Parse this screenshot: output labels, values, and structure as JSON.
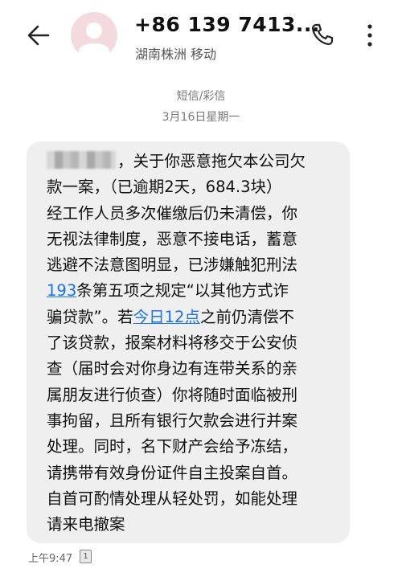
{
  "header": {
    "phone_number": "+86 139 7413...",
    "location": "湖南株洲 移动",
    "back_icon": "back-arrow-icon",
    "call_icon": "phone-icon",
    "more_icon": "more-vertical-icon",
    "avatar_color": "#f3dbdd"
  },
  "conversation": {
    "message_type": "短信/彩信",
    "date": "3月16日星期一"
  },
  "message": {
    "lines": [
      {
        "parts": [
          {
            "text": "",
            "type": "redacted"
          },
          {
            "text": "，关于你恶意拖欠本公司欠",
            "type": "text"
          }
        ]
      },
      {
        "parts": [
          {
            "text": "款一案，（已逾期2天，684.3块）",
            "type": "text"
          }
        ]
      },
      {
        "parts": [
          {
            "text": "经工作人员多次催缴后仍未清偿，你",
            "type": "text"
          }
        ]
      },
      {
        "parts": [
          {
            "text": "无视法律制度，恶意不接电话，蓄意",
            "type": "text"
          }
        ]
      },
      {
        "parts": [
          {
            "text": "逃避不法意图明显，已涉嫌触犯刑法",
            "type": "text"
          }
        ]
      },
      {
        "parts": [
          {
            "text": "193",
            "type": "link"
          },
          {
            "text": "条第五项之规定“以其他方式诈",
            "type": "text"
          }
        ]
      },
      {
        "parts": [
          {
            "text": "骗贷款”。若",
            "type": "text"
          },
          {
            "text": "今日12点",
            "type": "link"
          },
          {
            "text": "之前仍清偿不",
            "type": "text"
          }
        ]
      },
      {
        "parts": [
          {
            "text": "了该贷款，报案材料将移交于公安侦",
            "type": "text"
          }
        ]
      },
      {
        "parts": [
          {
            "text": "查（届时会对你身边有连带关系的亲",
            "type": "text"
          }
        ]
      },
      {
        "parts": [
          {
            "text": "属朋友进行侦查）你将随时面临被刑",
            "type": "text"
          }
        ]
      },
      {
        "parts": [
          {
            "text": "事拘留，且所有银行欠款会进行并案",
            "type": "text"
          }
        ]
      },
      {
        "parts": [
          {
            "text": "处理。同时，名下财产会给予冻结，",
            "type": "text"
          }
        ]
      },
      {
        "parts": [
          {
            "text": "请携带有效身份证件自主投案自首。",
            "type": "text"
          }
        ]
      },
      {
        "parts": [
          {
            "text": "自首可酌情处理从轻处罚，如能处理",
            "type": "text"
          }
        ]
      },
      {
        "parts": [
          {
            "text": "请来电撤案",
            "type": "text"
          }
        ]
      }
    ],
    "time": "上午9:47",
    "sim_badge": "1",
    "link_color": "#1a73e8"
  }
}
